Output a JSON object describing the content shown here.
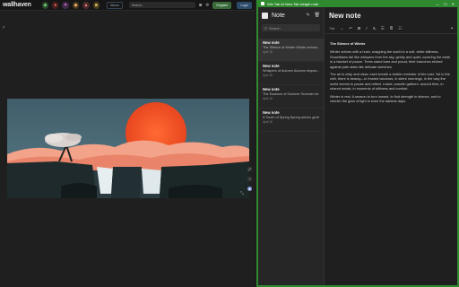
{
  "wallhaven": {
    "logo": "wallhaven",
    "album": "Album",
    "search_placeholder": "Search...",
    "register": "Register",
    "login": "Login"
  },
  "app": {
    "window_title": "Win Tab AI New Tab widget note",
    "pane_title": "Note",
    "search_placeholder": "Search",
    "editor_title": "New note",
    "style_label": "Title",
    "notes": [
      {
        "title": "New note",
        "snippet": "The Silence of Winter Winter arrives...",
        "date": "April 18"
      },
      {
        "title": "New note",
        "snippet": "Whispers of Autumn Autumn drapes...",
        "date": "April 18"
      },
      {
        "title": "New note",
        "snippet": "The Essence of Summer Summer be...",
        "date": "April 18"
      },
      {
        "title": "New note",
        "snippet": "A Touch of Spring Spring arrives gently...",
        "date": "April 18"
      }
    ],
    "content": {
      "heading": "The Silence of Winter",
      "p1": "Winter arrives with a hush, wrapping the world in a soft, white stillness. Snowflakes fall like whispers from the sky, gently and quiet, covering the earth in a blanket of peace. Trees stand bare and proud, their branches etched against pale skies like delicate sketches.",
      "p2": "The air is crisp and clear; each breath a visible reminder of the cold. Yet in the chill, there is beauty—in frosted windows, in silent mornings, in the way the world seems to pause and reflect. Inside, warmth gathers: around fires, in shared meals, in moments of stillness and comfort.",
      "p3": "Winter is rest. A season to turn inward, to find strength in silence, and to cherish the glow of light in even the darkest days."
    }
  }
}
